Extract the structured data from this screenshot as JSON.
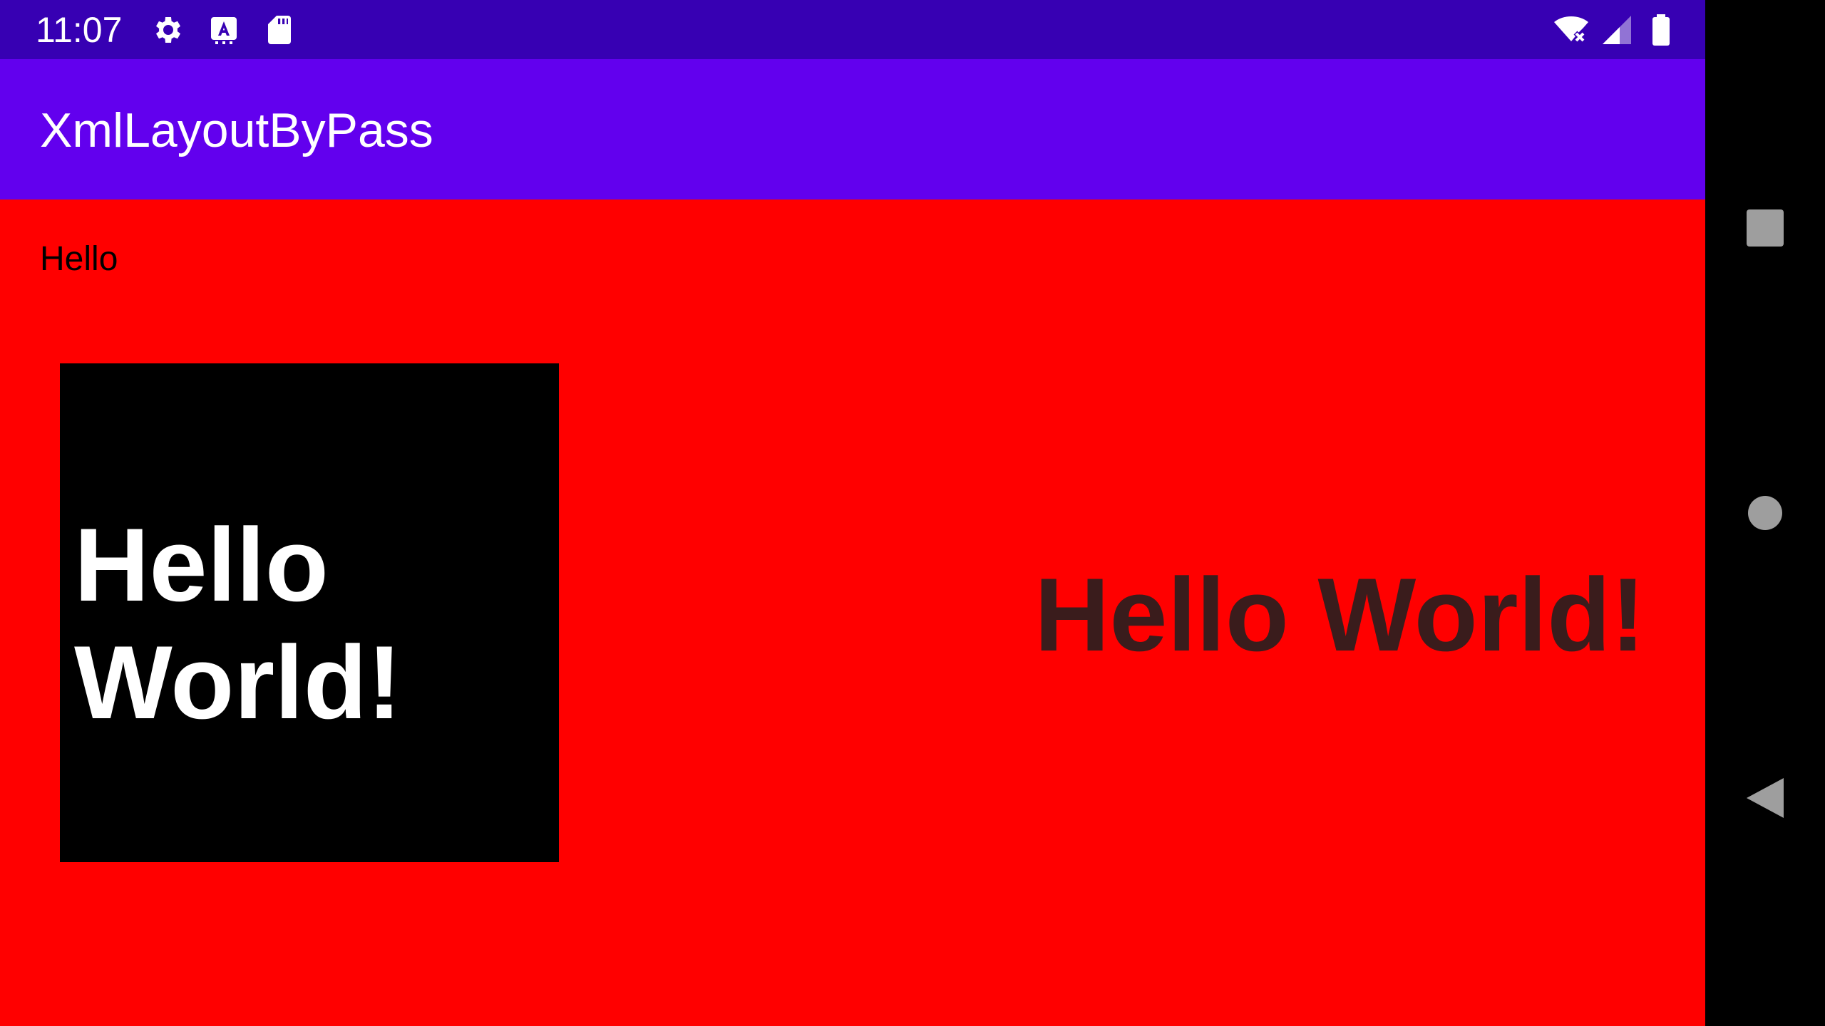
{
  "status_bar": {
    "time": "11:07",
    "icons": [
      "gear-icon",
      "keyboard-a-icon",
      "sd-card-icon",
      "wifi-off-icon",
      "signal-icon",
      "battery-icon"
    ],
    "background": "#3700b3"
  },
  "app_bar": {
    "title": "XmlLayoutByPass",
    "background": "#6200ee"
  },
  "content": {
    "background": "#ff0000",
    "small_label": "Hello",
    "box_text": "Hello World!",
    "large_text": "Hello World!"
  },
  "nav_bar": {
    "buttons": [
      "recents-square-icon",
      "home-circle-icon",
      "back-triangle-icon"
    ]
  }
}
